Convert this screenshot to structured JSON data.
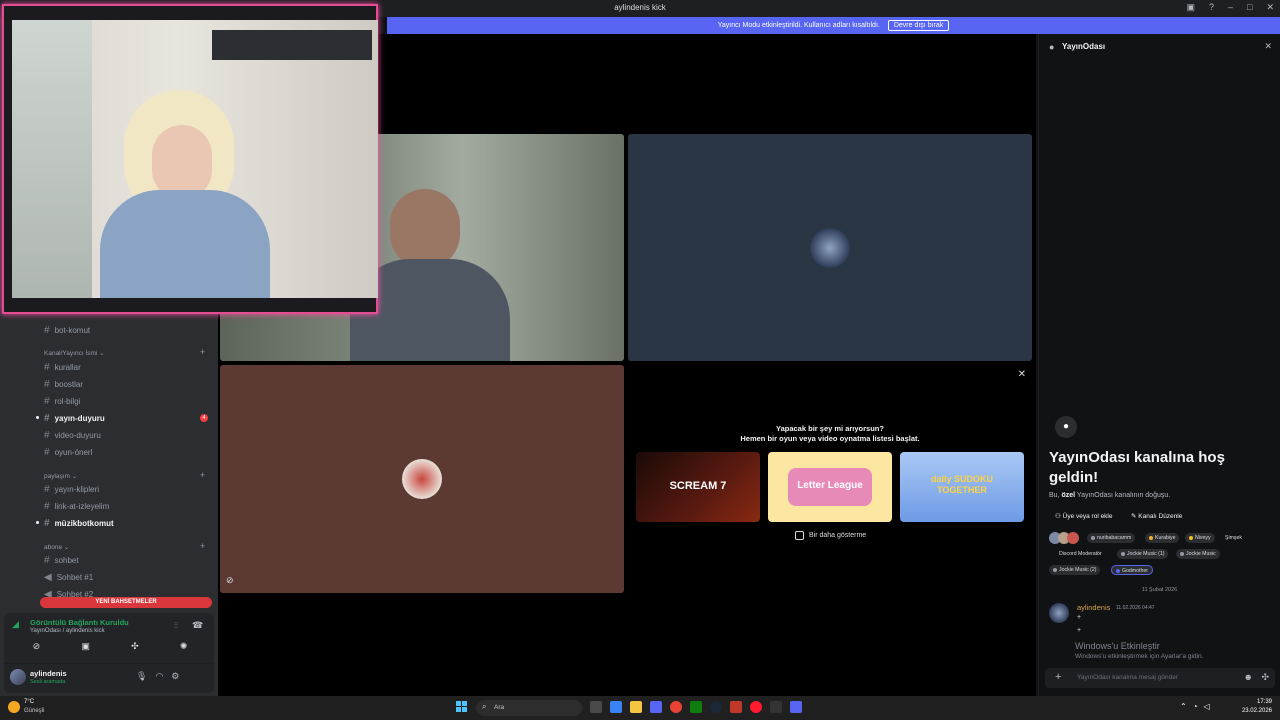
{
  "window": {
    "title": "aylindenis kick"
  },
  "streamer_mode": {
    "text": "Yayıncı Modu etkinleştirildi. Kullanıcı adları kısaltıldı.",
    "button": "Devre dışı bırak"
  },
  "sidebar": {
    "channels_top": [
      {
        "name": "bot-komut"
      }
    ],
    "category1": "Kanal/Yayıncı İsmi",
    "channels1": [
      {
        "name": "kurallar"
      },
      {
        "name": "boostlar"
      },
      {
        "name": "rol-bilgi"
      },
      {
        "name": "yayın-duyuru",
        "badge": "4"
      },
      {
        "name": "video-duyuru"
      },
      {
        "name": "oyun-önerl"
      }
    ],
    "category2": "paylaşım",
    "channels2": [
      {
        "name": "yayın-klipleri"
      },
      {
        "name": "link-at-izleyelim"
      },
      {
        "name": "müzikbotkomut"
      }
    ],
    "category3": "abone",
    "channels3": [
      {
        "name": "sohbet"
      },
      {
        "name": "Sohbet #1"
      },
      {
        "name": "Sohbet #2"
      }
    ],
    "new_mentions": "YENİ BAHSETMELER"
  },
  "voice": {
    "status": "Görüntülü Bağlantı Kuruldu",
    "location": "YayınOdası / aylindenis kick"
  },
  "user": {
    "name": "aylindenis",
    "status": "Sesli aramada"
  },
  "activity": {
    "line1": "Yapacak bir şey mi arıyorsun?",
    "line2": "Hemen bir oyun veya video oynatma listesi başlat.",
    "games": [
      "SCREAM 7",
      "Letter League",
      "daily SUDOKU TOGETHER"
    ],
    "dont_show": "Bir daha gösterme"
  },
  "panel": {
    "header": "YayınOdası",
    "welcome_title": "YayınOdası kanalına hoş geldin!",
    "welcome_sub_pre": "Bu,",
    "welcome_sub_bold": "özel",
    "welcome_sub_post": "YayınOdası kanalının doğuşu.",
    "add_role": "Üye veya rol ekle",
    "edit_channel": "Kanalı Düzenle",
    "roles": [
      {
        "name": "nuribabacamm",
        "color": "#949ba4"
      },
      {
        "name": "Kurabiye",
        "color": "#f0b232"
      },
      {
        "name": "Niveyy",
        "color": "#f0c419"
      },
      {
        "name": "Şimşek",
        "color": "#2b2d31"
      },
      {
        "name": "Discord Moderatör",
        "color": "#2b2d31"
      },
      {
        "name": "Jockie Music (1)",
        "color": "#949ba4"
      },
      {
        "name": "Jockie Music",
        "color": "#949ba4"
      },
      {
        "name": "Jockie Music (2)",
        "color": "#949ba4"
      },
      {
        "name": "Godmother",
        "color": "#5865f2"
      }
    ],
    "date_divider": "11 Şubat 2026",
    "message": {
      "author": "aylindenis",
      "time": "11.02.2026 04:47",
      "lines": [
        "+",
        "+"
      ]
    },
    "watermark1": "Windows'u Etkinleştir",
    "watermark2": "Windows'u etkinleştirmek için Ayarlar'a gidin.",
    "input_placeholder": "YayınOdası kanalına mesaj gönder"
  },
  "taskbar": {
    "weather_temp": "7°C",
    "weather_desc": "Güneşli",
    "search": "Ara",
    "time": "17:39",
    "date": "23.02.2026"
  },
  "colors": {
    "accent": "#5865f2",
    "danger": "#da373c",
    "online": "#23a55a",
    "tile_brown": "#5c3a33",
    "tile_slate": "#2b3645"
  }
}
